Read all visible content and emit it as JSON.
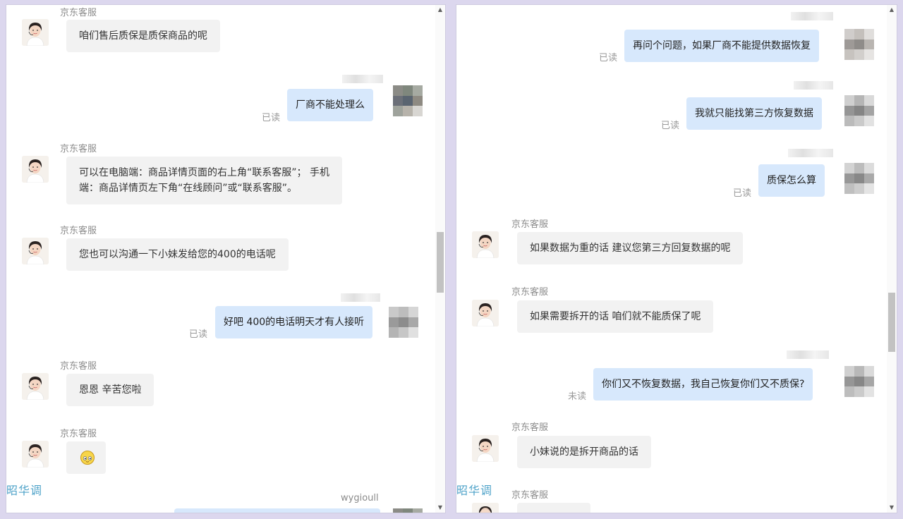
{
  "left_panel": {
    "customer_service_name": "京东客服",
    "messages": [
      {
        "text": "咱们售后质保是质保商品的呢"
      },
      {
        "text": "厂商不能处理么",
        "status": "已读"
      },
      {
        "line1": "可以在电脑端：商品详情页面的右上角“联系客服”；  手机",
        "line2": "端：商品详情页左下角“在线顾问”或“联系客服”。"
      },
      {
        "text": "您也可以沟通一下小妹发给您的400的电话呢"
      },
      {
        "text": "好吧 400的电话明天才有人接听",
        "status": "已读"
      },
      {
        "text": "恩恩 辛苦您啦"
      },
      {
        "emoji": "smiling-emoji"
      }
    ],
    "user_name_bottom": "wygioull",
    "watermark": "昭华调"
  },
  "right_panel": {
    "customer_service_name": "京东客服",
    "messages": [
      {
        "text": "再问个问题，如果厂商不能提供数据恢复",
        "status": "已读"
      },
      {
        "text": "我就只能找第三方恢复数据",
        "status": "已读"
      },
      {
        "text": "质保怎么算",
        "status": "已读"
      },
      {
        "text": "如果数据为重的话 建议您第三方回复数据的呢"
      },
      {
        "text": "如果需要拆开的话 咱们就不能质保了呢"
      },
      {
        "text": "你们又不恢复数据，我自己恢复你们又不质保?",
        "status": "未读"
      },
      {
        "text": "小妹说的是拆开商品的话"
      }
    ],
    "watermark": "昭华调"
  },
  "colors": {
    "incoming_bubble": "#f2f2f2",
    "outgoing_bubble": "#d7e8fc",
    "sender_label": "#8c8c8c",
    "watermark": "#4fa3c9"
  }
}
